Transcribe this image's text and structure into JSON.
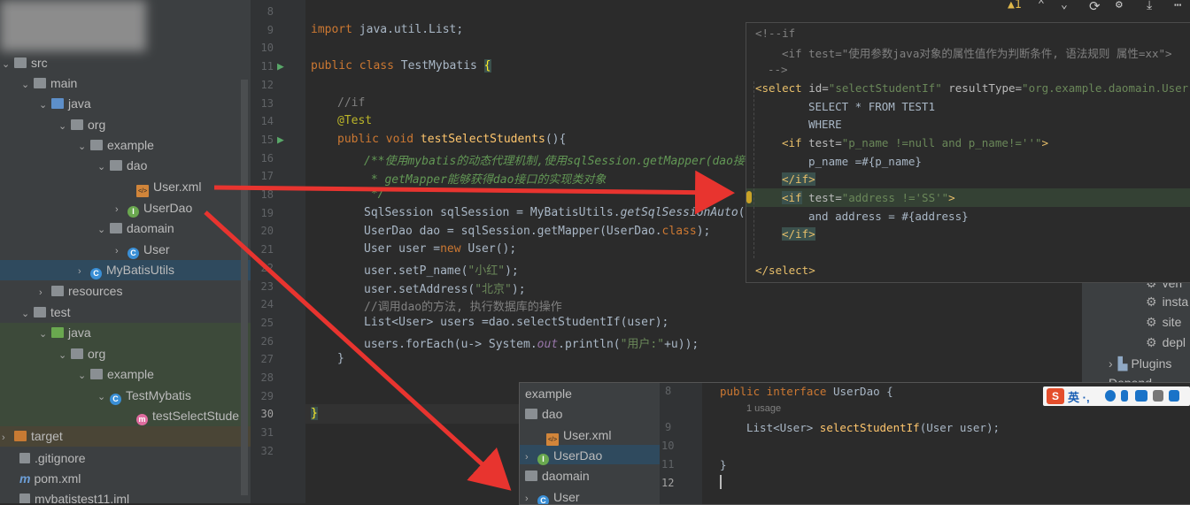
{
  "project_tree": {
    "items": [
      {
        "label": "src"
      },
      {
        "label": "main"
      },
      {
        "label": "java"
      },
      {
        "label": "org"
      },
      {
        "label": "example"
      },
      {
        "label": "dao"
      },
      {
        "label": "User.xml"
      },
      {
        "label": "UserDao"
      },
      {
        "label": "daomain"
      },
      {
        "label": "User"
      },
      {
        "label": "MyBatisUtils"
      },
      {
        "label": "resources"
      },
      {
        "label": "test"
      },
      {
        "label": "java"
      },
      {
        "label": "org"
      },
      {
        "label": "example"
      },
      {
        "label": "TestMybatis"
      },
      {
        "label": "testSelectStude"
      },
      {
        "label": "target"
      },
      {
        "label": ".gitignore"
      },
      {
        "label": "pom.xml"
      },
      {
        "label": "mybatistest11.iml"
      }
    ]
  },
  "editor": {
    "line_numbers": [
      "8",
      "9",
      "10",
      "11",
      "12",
      "13",
      "14",
      "15",
      "16",
      "17",
      "18",
      "19",
      "20",
      "21",
      "22",
      "23",
      "24",
      "25",
      "26",
      "27",
      "28",
      "29",
      "30",
      "31",
      "32"
    ],
    "current_line": "30",
    "lines": {
      "l9_kw": "import",
      "l9_rest": " java.util.List;",
      "l11_kw": "public class",
      "l11_name": " TestMybatis ",
      "l11_brace": "{",
      "l13": "//if",
      "l14": "@Test",
      "l15_kw": "public void",
      "l15_fn": " testSelectStudents",
      "l15_rest": "(){",
      "l16": "/**使用mybatis的动态代理机制,使用sqlSession.getMapper(dao接口)",
      "l17": " * getMapper能够获得dao接口的实现类对象",
      "l18": " */",
      "l19_a": "SqlSession sqlSession = MyBatisUtils.",
      "l19_b": "getSqlSessionAuto",
      "l19_c": "();",
      "l20_a": "UserDao dao = sqlSession.getMapper(UserDao.",
      "l20_b": "class",
      "l20_c": ");",
      "l21_a": "User user =",
      "l21_b": "new",
      "l21_c": " User();",
      "l22_a": "user.setP_name(",
      "l22_b": "\"小红\"",
      "l22_c": ");",
      "l23_a": "user.setAddress(",
      "l23_b": "\"北京\"",
      "l23_c": ");",
      "l24": "//调用dao的方法, 执行数据库的操作",
      "l25": "List<User> users =dao.selectStudentIf(user);",
      "l26_a": "users.forEach(u-> System.",
      "l26_b": "out",
      "l26_c": ".println(",
      "l26_d": "\"用户:\"",
      "l26_e": "+u));",
      "l27": "}",
      "l30": "}"
    }
  },
  "toolbar": {
    "warning_count": "▲1",
    "up": "⌃",
    "down": "⌄"
  },
  "xml_popup": {
    "c1": "<!--if",
    "c2": "<if test=\"使用参数java对象的属性值作为判断条件, 语法规则 属性=xx\">",
    "c3": "-->",
    "sel_open_tag": "<select",
    "sel_id_attr": " id=",
    "sel_id_val": "\"selectStudentIf\"",
    "sel_rt_attr": " resultType=",
    "sel_rt_val": "\"org.example.daomain.User\"",
    "sql1": "SELECT * FROM TEST1",
    "sql2": "WHERE",
    "if1_tag": "<if",
    "if1_attr": " test=",
    "if1_val": "\"p_name !=null and p_name!=''\"",
    "if1_close": ">",
    "if1_body": "p_name =#{p_name}",
    "if1_end": "</if>",
    "if2_tag": "<if",
    "if2_attr": " test=",
    "if2_val": "\"address !='SS'\"",
    "if2_close": ">",
    "if2_body": "and address = #{address}",
    "if2_end": "</if>",
    "sel_end": "</select>"
  },
  "bottom_popup": {
    "tree": [
      "example",
      "dao",
      "User.xml",
      "UserDao",
      "daomain",
      "User"
    ],
    "line_numbers": [
      "8",
      "9",
      "10",
      "11",
      "12"
    ],
    "l8_kw": "public interface",
    "l8_rest": " UserDao {",
    "usage": "1 usage",
    "l9_a": "List<User> ",
    "l9_fn": "selectStudentIf",
    "l9_c": "(User user);",
    "l11": "}"
  },
  "right_panel": {
    "items": [
      "veri",
      "insta",
      "site",
      "depl",
      "Plugins",
      "Depend"
    ]
  },
  "ime": {
    "logo": "S",
    "label": "英 ·,"
  },
  "colors": {
    "arrow": "#e8342f",
    "keyword": "#cc7832",
    "string": "#6a8759",
    "function": "#ffc66d"
  }
}
